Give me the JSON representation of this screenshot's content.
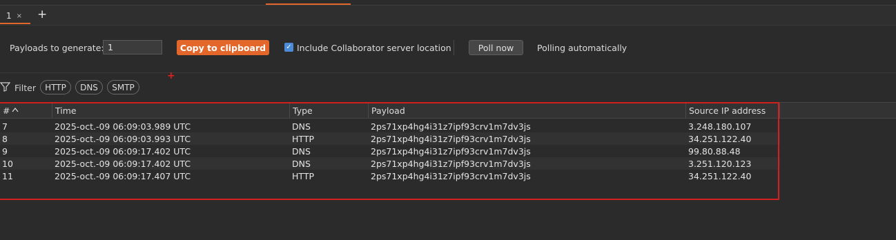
{
  "tabs": [
    {
      "label": "1",
      "close": "×"
    }
  ],
  "add_tab": "+",
  "toolbar": {
    "payloads_label": "Payloads to generate:",
    "payloads_value": "1",
    "copy_label": "Copy to clipboard",
    "include_label": "Include Collaborator server location",
    "include_checked": true,
    "poll_label": "Poll now",
    "polling_status": "Polling automatically"
  },
  "annotation_plus": "+",
  "filter": {
    "label": "Filter",
    "pills": [
      "HTTP",
      "DNS",
      "SMTP"
    ]
  },
  "table": {
    "columns": [
      "#",
      "Time",
      "Type",
      "Payload",
      "Source IP address"
    ],
    "sort_indicator": "^",
    "rows": [
      {
        "num": "7",
        "time": "2025-oct.-09 06:09:03.989 UTC",
        "type": "DNS",
        "payload": "2ps71xp4hg4i31z7ipf93crv1m7dv3js",
        "ip": "3.248.180.107"
      },
      {
        "num": "8",
        "time": "2025-oct.-09 06:09:03.993 UTC",
        "type": "HTTP",
        "payload": "2ps71xp4hg4i31z7ipf93crv1m7dv3js",
        "ip": "34.251.122.40"
      },
      {
        "num": "9",
        "time": "2025-oct.-09 06:09:17.402 UTC",
        "type": "DNS",
        "payload": "2ps71xp4hg4i31z7ipf93crv1m7dv3js",
        "ip": "99.80.88.48"
      },
      {
        "num": "10",
        "time": "2025-oct.-09 06:09:17.402 UTC",
        "type": "DNS",
        "payload": "2ps71xp4hg4i31z7ipf93crv1m7dv3js",
        "ip": "3.251.120.123"
      },
      {
        "num": "11",
        "time": "2025-oct.-09 06:09:17.407 UTC",
        "type": "HTTP",
        "payload": "2ps71xp4hg4i31z7ipf93crv1m7dv3js",
        "ip": "34.251.122.40"
      }
    ]
  },
  "colors": {
    "accent": "#e3672b",
    "annotation": "#d41f1f",
    "background": "#2b2b2b"
  }
}
